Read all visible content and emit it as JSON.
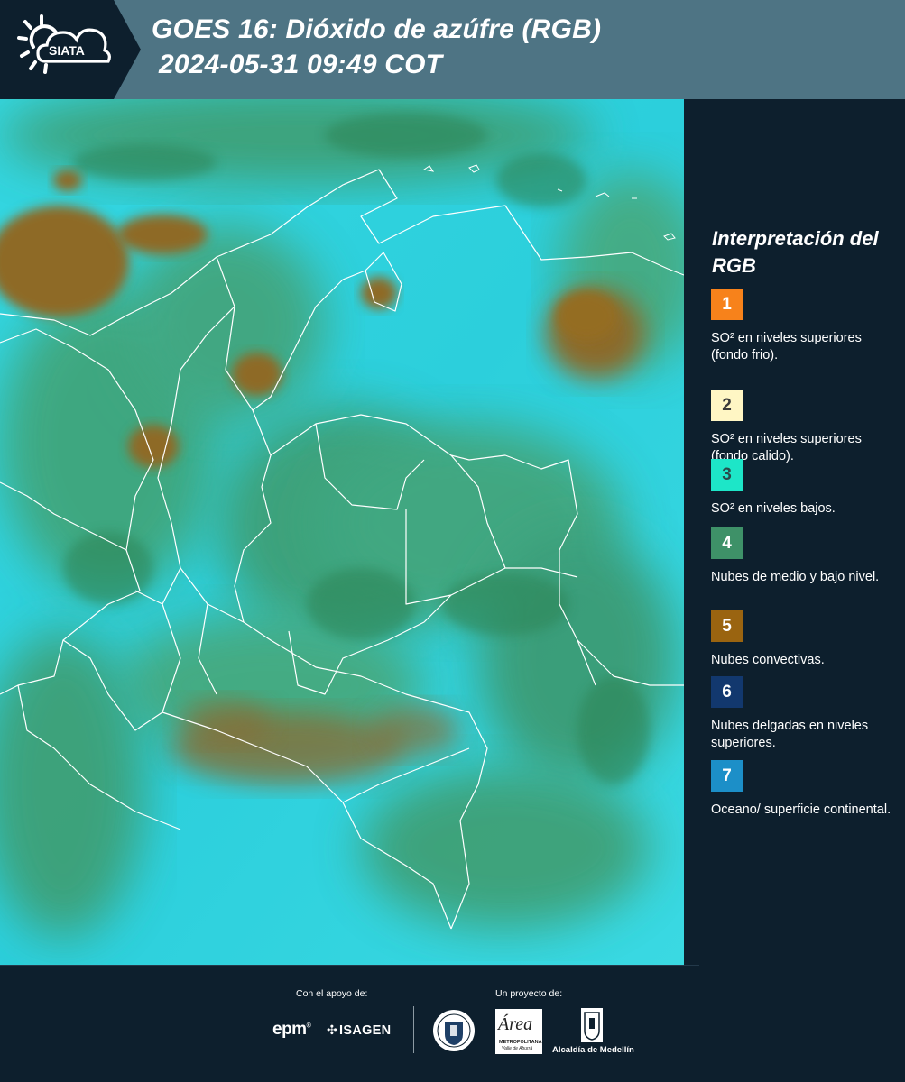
{
  "header": {
    "logo_text": "SIATA",
    "title_line1": "GOES 16: Dióxido de azúfre (RGB)",
    "title_line2": "2024-05-31 09:49 COT"
  },
  "legend": {
    "title": "Interpretación del RGB",
    "items": [
      {
        "number": "1",
        "color": "#f7821b",
        "number_color": "#ffffff",
        "text": "SO² en niveles superiores (fondo frio)."
      },
      {
        "number": "2",
        "color": "#fff6c4",
        "number_color": "#3a3a3a",
        "text": "SO² en niveles superiores (fondo calido)."
      },
      {
        "number": "3",
        "color": "#1de6c8",
        "number_color": "#2a4a4a",
        "text": "SO² en niveles bajos."
      },
      {
        "number": "4",
        "color": "#3e9168",
        "number_color": "#ffffff",
        "text": "Nubes de medio y bajo nivel."
      },
      {
        "number": "5",
        "color": "#9a6410",
        "number_color": "#ffffff",
        "text": "Nubes convectivas."
      },
      {
        "number": "6",
        "color": "#12386e",
        "number_color": "#ffffff",
        "text": "Nubes delgadas en niveles superiores."
      },
      {
        "number": "7",
        "color": "#1c8fc8",
        "number_color": "#ffffff",
        "text": "Oceano/ superficie continental."
      }
    ]
  },
  "footer": {
    "support_caption": "Con el apoyo de:",
    "project_caption": "Un proyecto de:",
    "epm_text": "epm",
    "isagen_text": "ISAGEN",
    "area_text": "Área",
    "area_sub1": "METROPOLITANA",
    "area_sub2": "Valle de Aburrá",
    "alcaldia_text": "Alcaldía de Medellín"
  },
  "colors": {
    "header_bg": "#4e7484",
    "logo_bg": "#0d1f2d",
    "page_bg": "#0d1f2d",
    "map_cyan": "#2fd3df",
    "map_green": "#3f9a6a",
    "map_brown": "#8a6a2a"
  }
}
